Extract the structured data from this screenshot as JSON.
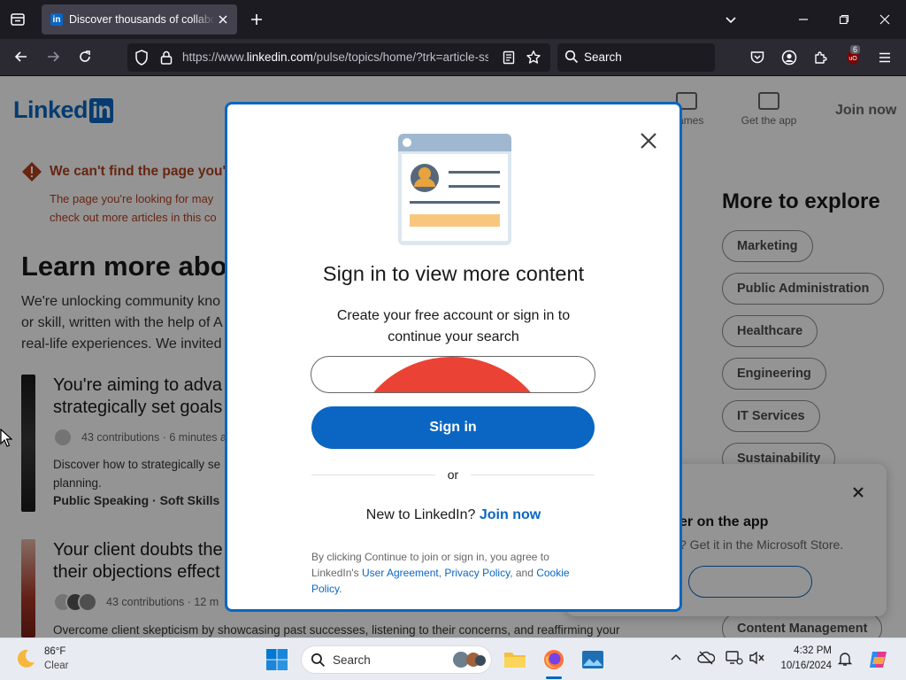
{
  "browser": {
    "tab_title": "Discover thousands of collaborative articles",
    "tab_favicon": "in",
    "url_prefix": "https://www.",
    "url_host": "linkedin.com",
    "url_path": "/pulse/topics/home/?trk=article-ssr-frontend-pulse",
    "search_placeholder": "Search",
    "ublock_count": "6"
  },
  "linkedin": {
    "logo_text": "Linked",
    "logo_in": "in",
    "nav_games_label": "Games",
    "nav_getapp_label": "Get the app",
    "join_now": "Join now",
    "error_title": "We can't find the page you're looking for",
    "error_body_line1": "The page you're looking for may",
    "error_body_line2": "check out more articles in this co",
    "learn_title": "Learn more about",
    "learn_body_line1": "We're unlocking community kno",
    "learn_body_line2": "or skill, written with the help of A",
    "learn_body_line3": "real-life experiences. We invited",
    "articles": [
      {
        "title_line1": "You're aiming to adva",
        "title_line2": "strategically set goals",
        "meta": "43 contributions · 6 minutes a",
        "desc_line1": "Discover how to strategically se",
        "desc_line2": "planning.",
        "tags": "Public Speaking · Soft Skills"
      },
      {
        "title_line1": "Your client doubts the",
        "title_line2": "their objections effect",
        "meta": "43 contributions · 12 m",
        "desc_line1": "Overcome client skepticism by showcasing past successes, listening to their concerns, and reaffirming your"
      }
    ],
    "explore_title": "More to explore",
    "explore_topics": [
      "Marketing",
      "Public Administration",
      "Healthcare",
      "Engineering",
      "IT Services",
      "Sustainability",
      "Content Management"
    ],
    "promo_title": "er on the app",
    "promo_text": "? Get it in the Microsoft Store."
  },
  "modal": {
    "title": "Sign in to view more content",
    "subtitle": "Create your free account or sign in to\ncontinue your search",
    "signin_label": "Sign in",
    "or_label": "or",
    "new_to": "New to LinkedIn?",
    "join_now": "Join now",
    "legal_prefix": "By clicking Continue to join or sign in, you agree to LinkedIn's ",
    "user_agreement": "User Agreement",
    "comma": ", ",
    "privacy_policy": "Privacy Policy",
    "and": ", and ",
    "cookie_policy": "Cookie Policy",
    "period": "."
  },
  "taskbar": {
    "weather_temp": "86°F",
    "weather_cond": "Clear",
    "search_label": "Search",
    "time": "4:32 PM",
    "date": "10/16/2024"
  },
  "colors": {
    "linkedin_blue": "#0a66c2",
    "error_red": "#b24020",
    "browser_dark": "#1c1b22"
  }
}
